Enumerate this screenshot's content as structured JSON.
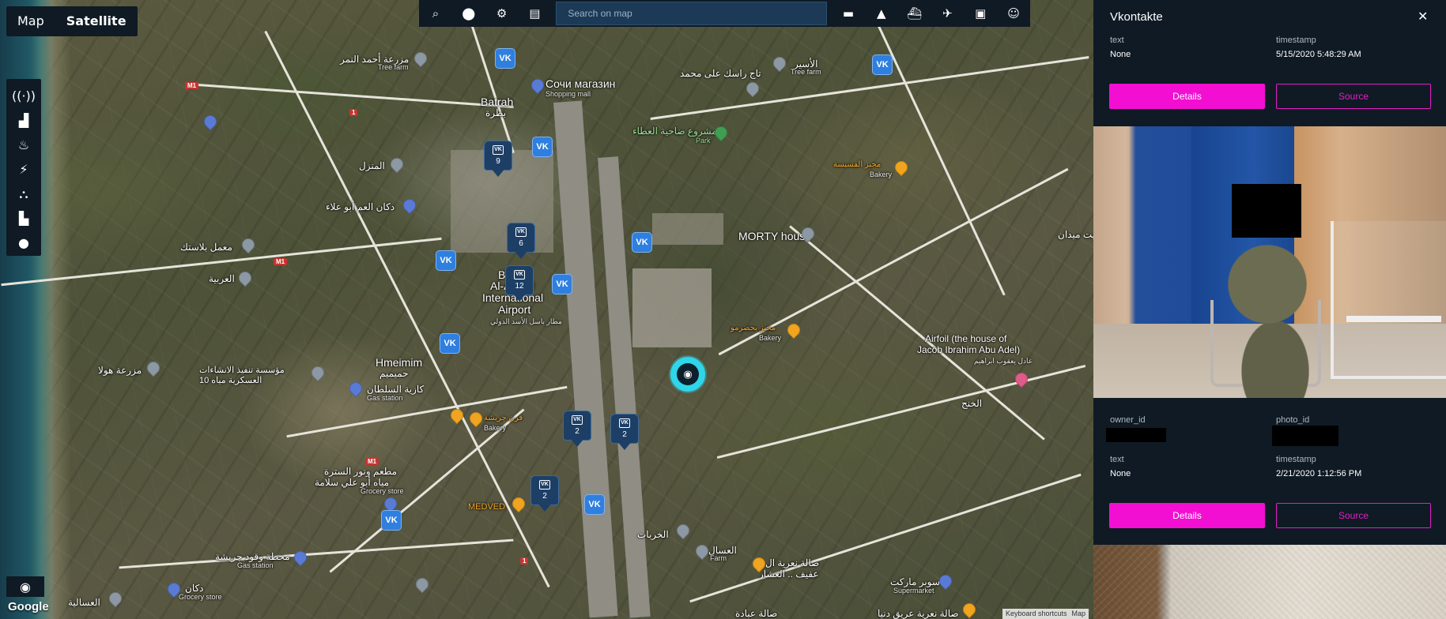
{
  "map": {
    "type_toggle": [
      "Map",
      "Satellite"
    ],
    "active_type": "Satellite",
    "search_placeholder": "Search on map",
    "google_logo": "Google",
    "attribution": [
      "Keyboard shortcuts",
      "Map"
    ],
    "layer_rail_icons": [
      "antenna-icon",
      "ambulance-icon",
      "firefighter-icon",
      "lightning-icon",
      "network-icon",
      "truck-icon",
      "water-drop-icon"
    ],
    "toolbar_left_icons": [
      "zoom-search-icon",
      "map-pin-icon",
      "gear-icon",
      "layers-icon"
    ],
    "toolbar_right_icons": [
      "car-icon",
      "warning-icon",
      "ship-icon",
      "plane-icon",
      "bus-icon",
      "face-icon"
    ],
    "labels": {
      "tree_farm_1": "مزرعة أحمد النمر",
      "tree_farm_1_sub": "Tree farm",
      "sochi_shop": "Сочи магазин",
      "sochi_shop_sub": "Shopping mall",
      "batrah": "Batrah",
      "batrah_ar": "بطرة",
      "park": "مشروع ضاحية العطاء",
      "park_sub": "Park",
      "tree_farm_2": "الأسير",
      "tree_farm_2_sub": "Tree farm",
      "taj": "تاج راسك على محمد",
      "manzil": "المنزل",
      "dukkan": "دكان العم أبو علاء",
      "bakery_1": "مخبز الفسيسة",
      "bakery_1_sub": "Bakery",
      "maamal": "معمل بلاستك",
      "morty": "MORTY house",
      "arabiya": "العربية",
      "airport_1": "Bassel",
      "airport_2": "Al-Assad",
      "airport_3": "International",
      "airport_4": "Airport",
      "airport_ar": "مطار باسل الأسد الدولي",
      "bakery_2": "مخبز بحضرمو",
      "bakery_2_sub": "Bakery",
      "airfoil_1": "Airfoil (the house of",
      "airfoil_2": "Jacob Ibrahim Abu Adel)",
      "airfoil_ar": "عادل يعقوب ابراهيم",
      "hmeimim": "Hmeimim",
      "hmeimim_ar": "حميميم",
      "mazraa": "مزرعة هولا",
      "muassasa": "مؤسسة تنفيذ الانشاءات العسكرية مياه 10",
      "gas_1": "كازية السلطان",
      "gas_1_sub": "Gas station",
      "bakery_3": "فرن جريشة",
      "bakery_3_sub": "Bakery",
      "khanj": "الخنج",
      "restaurant": "مطعم ونور السترة",
      "grocery_1": "مياه أبو علي سلامة",
      "grocery_1_sub": "Grocery store",
      "medved": "MEDVED",
      "kharabat": "الخربات",
      "assal": "العسال",
      "assal_sub": "Farm",
      "hall": "صالة نعرية ال",
      "hall_2": "عفيف .. العشار",
      "supermarket": "سوبر ماركت",
      "supermarket_sub": "Supermarket",
      "gas_2": "محطة وقود جريشة",
      "gas_2_sub": "Gas station",
      "grocery_2": "دكان",
      "grocery_2_sub": "Grocery store",
      "asaliya": "العسالية",
      "bottom_1": "صالة عبادة",
      "bottom_2": "صالة نعرية عريق دنيا",
      "right_edge": "بيت ميدان"
    },
    "clusters": [
      "9",
      "6",
      "12",
      "2",
      "2",
      "2"
    ],
    "vk_badge": "VK",
    "road_shields": [
      "M1",
      "M1",
      "M1",
      "1",
      "1",
      "1"
    ]
  },
  "panel": {
    "title": "Vkontakte",
    "close_icon": "close-icon",
    "record1": {
      "text_label": "text",
      "text_value": "None",
      "timestamp_label": "timestamp",
      "timestamp_value": "5/15/2020 5:48:29 AM",
      "details_label": "Details",
      "source_label": "Source"
    },
    "record2": {
      "owner_label": "owner_id",
      "photo_label": "photo_id",
      "text_label": "text",
      "text_value": "None",
      "timestamp_label": "timestamp",
      "timestamp_value": "2/21/2020 1:12:56 PM",
      "details_label": "Details",
      "source_label": "Source"
    }
  },
  "colors": {
    "panel_bg": "#0f1a24",
    "accent": "#f20fd2",
    "vk_blue": "#2f7fe0",
    "selected": "#2fd5e8"
  }
}
